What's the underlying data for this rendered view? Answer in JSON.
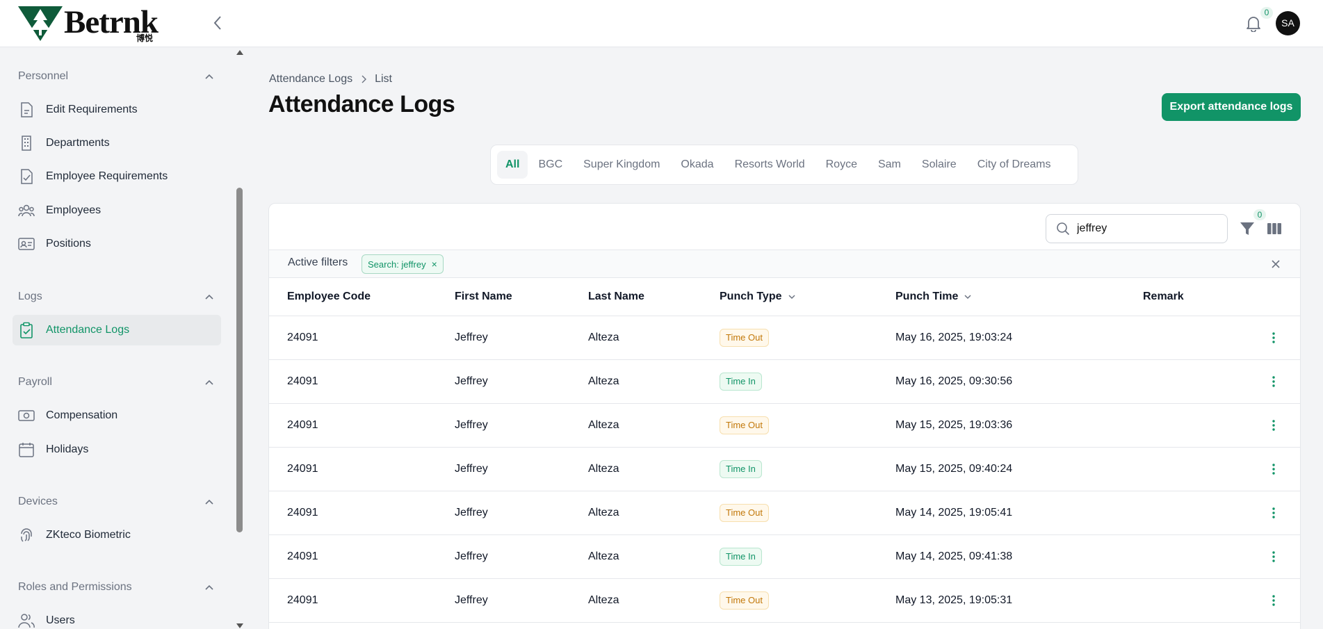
{
  "brand": {
    "name": "Betrnk",
    "subtitle": "博悦"
  },
  "header": {
    "notifications_count": "0",
    "avatar_initials": "SA"
  },
  "colors": {
    "accent": "#119467",
    "time_out": "#c2780a",
    "time_in": "#119467"
  },
  "sidebar": {
    "sections": [
      {
        "title": "Personnel",
        "items": [
          {
            "label": "Edit Requirements",
            "icon": "document-icon"
          },
          {
            "label": "Departments",
            "icon": "building-icon"
          },
          {
            "label": "Employee Requirements",
            "icon": "file-check-icon"
          },
          {
            "label": "Employees",
            "icon": "users-group-icon"
          },
          {
            "label": "Positions",
            "icon": "id-card-icon"
          }
        ]
      },
      {
        "title": "Logs",
        "items": [
          {
            "label": "Attendance Logs",
            "icon": "clipboard-check-icon",
            "active": true
          }
        ]
      },
      {
        "title": "Payroll",
        "items": [
          {
            "label": "Compensation",
            "icon": "cash-icon"
          },
          {
            "label": "Holidays",
            "icon": "calendar-icon"
          }
        ]
      },
      {
        "title": "Devices",
        "items": [
          {
            "label": "ZKteco Biometric",
            "icon": "fingerprint-icon"
          }
        ]
      },
      {
        "title": "Roles and Permissions",
        "items": [
          {
            "label": "Users",
            "icon": "users-icon"
          }
        ]
      }
    ]
  },
  "breadcrumb": {
    "parent": "Attendance Logs",
    "current": "List"
  },
  "page": {
    "title": "Attendance Logs",
    "export_label": "Export attendance logs"
  },
  "tabs": [
    "All",
    "BGC",
    "Super Kingdom",
    "Okada",
    "Resorts World",
    "Royce",
    "Sam",
    "Solaire",
    "City of Dreams"
  ],
  "active_tab": "All",
  "search": {
    "value": "jeffrey",
    "placeholder": ""
  },
  "filter_count": "0",
  "active_filters": {
    "label": "Active filters",
    "chips": [
      "Search: jeffrey"
    ]
  },
  "table": {
    "columns": [
      "Employee Code",
      "First Name",
      "Last Name",
      "Punch Type",
      "Punch Time",
      "Remark"
    ],
    "rows": [
      {
        "code": "24091",
        "first": "Jeffrey",
        "last": "Alteza",
        "type": "Time Out",
        "time": "May 16, 2025, 19:03:24",
        "remark": ""
      },
      {
        "code": "24091",
        "first": "Jeffrey",
        "last": "Alteza",
        "type": "Time In",
        "time": "May 16, 2025, 09:30:56",
        "remark": ""
      },
      {
        "code": "24091",
        "first": "Jeffrey",
        "last": "Alteza",
        "type": "Time Out",
        "time": "May 15, 2025, 19:03:36",
        "remark": ""
      },
      {
        "code": "24091",
        "first": "Jeffrey",
        "last": "Alteza",
        "type": "Time In",
        "time": "May 15, 2025, 09:40:24",
        "remark": ""
      },
      {
        "code": "24091",
        "first": "Jeffrey",
        "last": "Alteza",
        "type": "Time Out",
        "time": "May 14, 2025, 19:05:41",
        "remark": ""
      },
      {
        "code": "24091",
        "first": "Jeffrey",
        "last": "Alteza",
        "type": "Time In",
        "time": "May 14, 2025, 09:41:38",
        "remark": ""
      },
      {
        "code": "24091",
        "first": "Jeffrey",
        "last": "Alteza",
        "type": "Time Out",
        "time": "May 13, 2025, 19:05:31",
        "remark": ""
      }
    ]
  }
}
